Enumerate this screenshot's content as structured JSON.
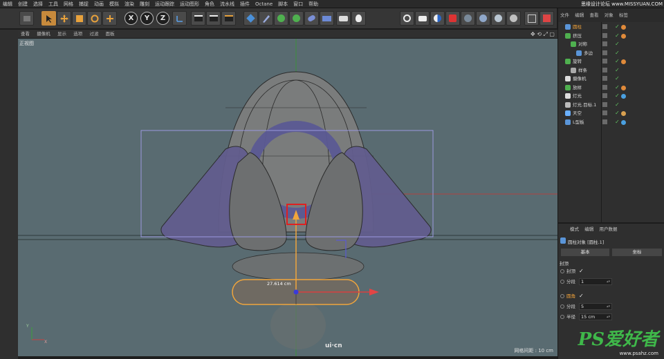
{
  "menubar": {
    "items": [
      "编辑",
      "创建",
      "选择",
      "工具",
      "网格",
      "捕捉",
      "动画",
      "模拟",
      "渲染",
      "雕刻",
      "运动跟踪",
      "运动图形",
      "角色",
      "流水线",
      "插件",
      "Octane",
      "脚本",
      "窗口",
      "帮助"
    ]
  },
  "top_watermark": "思缘设计论坛  www.MISSYUAN.COM",
  "toolbar": {
    "axis_labels": [
      "X",
      "Y",
      "Z"
    ]
  },
  "viewport": {
    "menu": [
      "查看",
      "摄像机",
      "显示",
      "选项",
      "过滤",
      "面板"
    ],
    "view_name": "正视图",
    "measure_label": "27.614 cm",
    "grid_spacing": "网格间距 : 10 cm",
    "logo_text": "ui·cn"
  },
  "object_manager": {
    "header": [
      "文件",
      "编辑",
      "查看",
      "对象",
      "标签"
    ],
    "objects": [
      {
        "name": "圆柱",
        "indent": 0,
        "selected": true
      },
      {
        "name": "挤压",
        "indent": 0,
        "selected": false
      },
      {
        "name": "对称",
        "indent": 1,
        "selected": false
      },
      {
        "name": "多边",
        "indent": 2,
        "selected": false
      },
      {
        "name": "旋转",
        "indent": 0,
        "selected": false
      },
      {
        "name": "样条",
        "indent": 1,
        "selected": false
      },
      {
        "name": "摄像机",
        "indent": 0,
        "selected": false
      },
      {
        "name": "放样",
        "indent": 0,
        "selected": false
      },
      {
        "name": "灯光",
        "indent": 0,
        "selected": false
      },
      {
        "name": "灯光.目标.1",
        "indent": 0,
        "selected": false
      },
      {
        "name": "天空",
        "indent": 0,
        "selected": false
      },
      {
        "name": "L型板",
        "indent": 0,
        "selected": false
      }
    ]
  },
  "attributes": {
    "tabs": [
      "模式",
      "编辑",
      "用户数据"
    ],
    "object_title": "圆柱对象 [圆柱.1]",
    "buttons": [
      "基本",
      "坐标"
    ],
    "section": "封顶",
    "fields": [
      {
        "label": "封顶",
        "type": "check",
        "value": "✓",
        "highlight": false
      },
      {
        "label": "分段",
        "type": "input",
        "value": "1",
        "highlight": false
      },
      {
        "label": "圆角",
        "type": "check",
        "value": "✓",
        "highlight": true
      },
      {
        "label": "分段",
        "type": "input",
        "value": "5",
        "highlight": false
      },
      {
        "label": "半径",
        "type": "input",
        "value": "15 cm",
        "highlight": false
      }
    ]
  },
  "watermark": {
    "big": "PS爱好者",
    "small": "www.psahz.com"
  },
  "colors": {
    "accent": "#f2a33a",
    "viewport_bg": "#596b71",
    "selection_blue": "#8c8cd8"
  }
}
